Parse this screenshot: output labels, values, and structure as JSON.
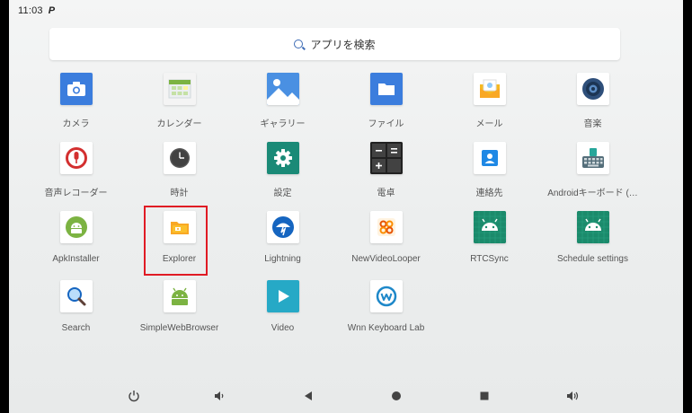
{
  "status_bar": {
    "time": "11:03",
    "notification_icon": "p-notification-icon"
  },
  "search": {
    "label": "アプリを検索",
    "icon": "search-icon"
  },
  "apps": [
    [
      {
        "id": "camera",
        "label": "カメラ",
        "icon": "camera-icon",
        "color": "#3b7ddd"
      },
      {
        "id": "calendar",
        "label": "カレンダー",
        "icon": "calendar-icon",
        "color": "#7cb342"
      },
      {
        "id": "gallery",
        "label": "ギャラリー",
        "icon": "gallery-icon",
        "color": "#4a90e2"
      },
      {
        "id": "files",
        "label": "ファイル",
        "icon": "folder-icon",
        "color": "#3b7ddd"
      },
      {
        "id": "mail",
        "label": "メール",
        "icon": "mail-icon",
        "color": "#f5b921"
      },
      {
        "id": "music",
        "label": "音楽",
        "icon": "speaker-icon",
        "color": "#2e4f7a"
      }
    ],
    [
      {
        "id": "recorder",
        "label": "音声レコーダー",
        "icon": "microphone-icon",
        "color": "#d32f2f"
      },
      {
        "id": "clock",
        "label": "時計",
        "icon": "clock-icon",
        "color": "#555555"
      },
      {
        "id": "settings",
        "label": "設定",
        "icon": "gear-icon",
        "color": "#1a8a77"
      },
      {
        "id": "calculator",
        "label": "電卓",
        "icon": "calculator-icon",
        "color": "#424242"
      },
      {
        "id": "contacts",
        "label": "連絡先",
        "icon": "contacts-icon",
        "color": "#1e88e5"
      },
      {
        "id": "keyboard",
        "label": "Androidキーボード (…",
        "icon": "keyboard-icon",
        "color": "#607d8b"
      }
    ],
    [
      {
        "id": "apkinstaller",
        "label": "ApkInstaller",
        "icon": "android-icon",
        "color": "#7cb342"
      },
      {
        "id": "explorer",
        "label": "Explorer",
        "icon": "explorer-folder-icon",
        "color": "#f9a825"
      },
      {
        "id": "lightning",
        "label": "Lightning",
        "icon": "lightning-icon",
        "color": "#1565c0"
      },
      {
        "id": "newvideolooper",
        "label": "NewVideoLooper",
        "icon": "video-looper-icon",
        "color": "#e65100"
      },
      {
        "id": "rtcsync",
        "label": "RTCSync",
        "icon": "android-icon",
        "color": "#1b8a6b"
      },
      {
        "id": "schedule",
        "label": "Schedule settings",
        "icon": "android-icon",
        "color": "#1b8a6b"
      }
    ],
    [
      {
        "id": "search",
        "label": "Search",
        "icon": "magnifier-icon",
        "color": "#1565c0"
      },
      {
        "id": "simplewebbrowser",
        "label": "SimpleWebBrowser",
        "icon": "android-icon",
        "color": "#7cb342"
      },
      {
        "id": "video",
        "label": "Video",
        "icon": "play-icon",
        "color": "#26a9c6"
      },
      {
        "id": "wnn",
        "label": "Wnn Keyboard Lab",
        "icon": "wnn-icon",
        "color": "#1e88c9"
      }
    ]
  ],
  "highlighted_app": "explorer",
  "highlight_color": "#e01b24",
  "navbar": [
    {
      "id": "power",
      "icon": "power-icon"
    },
    {
      "id": "volume-down",
      "icon": "volume-down-icon"
    },
    {
      "id": "back",
      "icon": "back-icon"
    },
    {
      "id": "home",
      "icon": "home-icon"
    },
    {
      "id": "recents",
      "icon": "recents-icon"
    },
    {
      "id": "volume-up",
      "icon": "volume-up-icon"
    }
  ]
}
